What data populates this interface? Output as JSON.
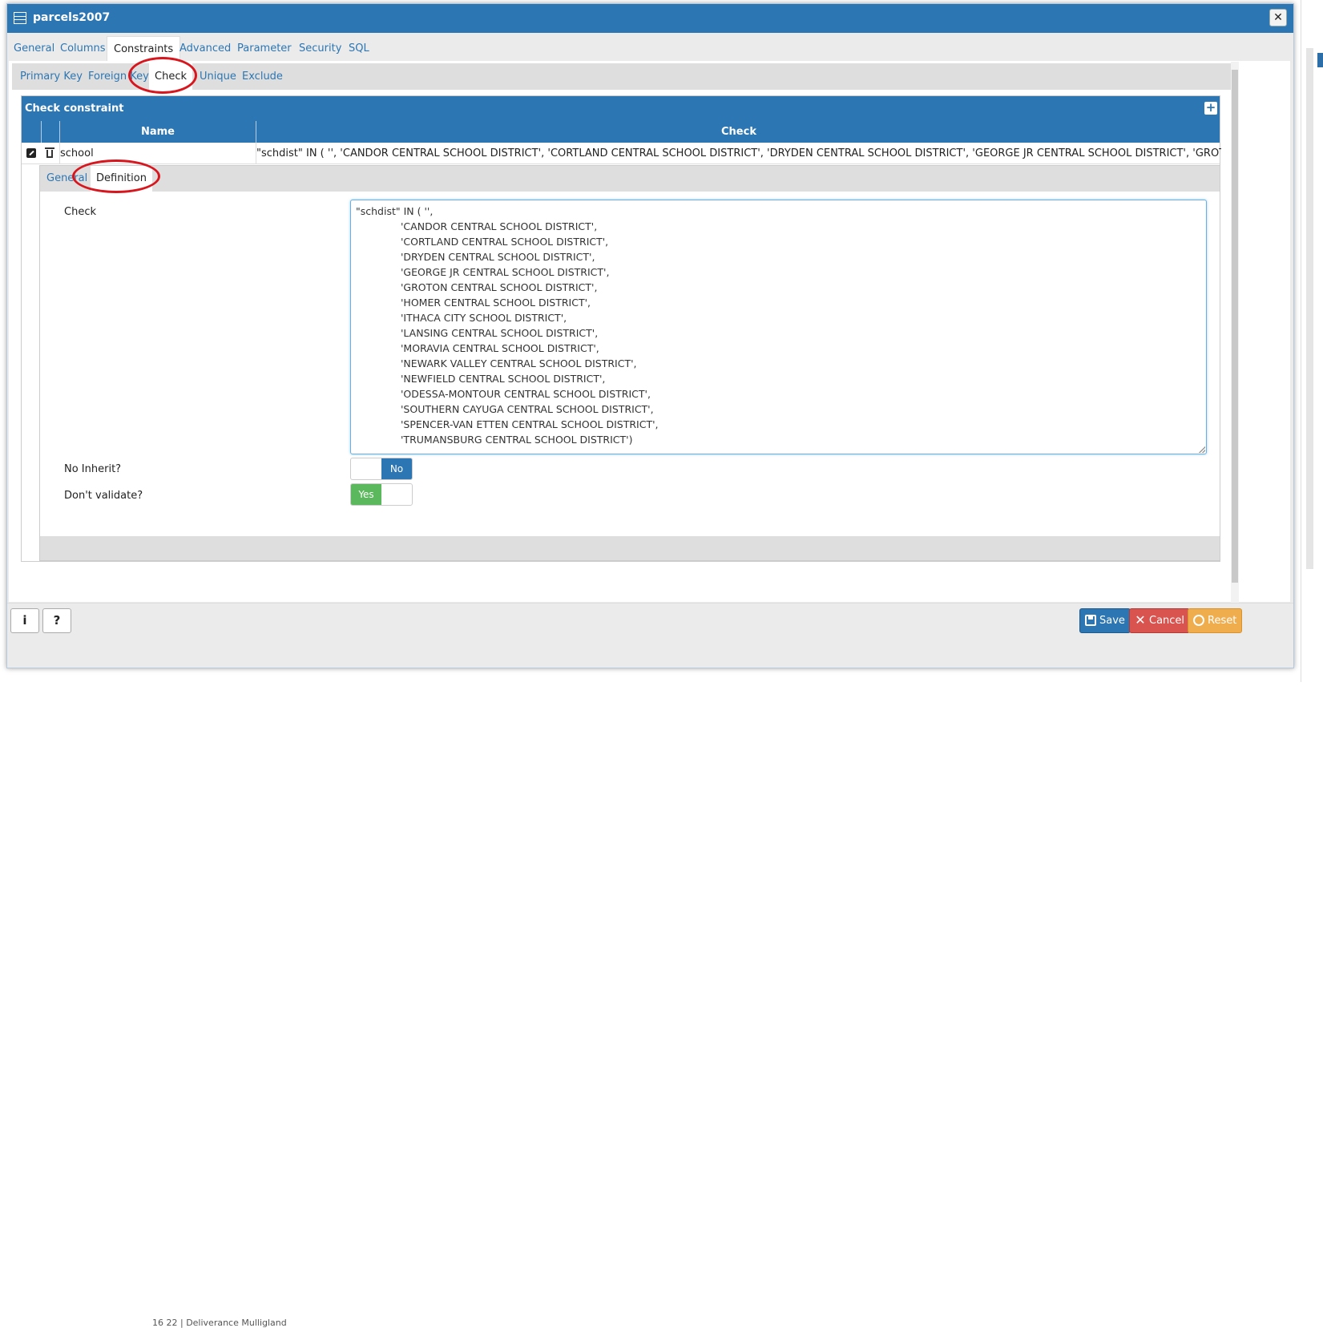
{
  "window": {
    "title": "parcels2007"
  },
  "main_tabs": [
    {
      "label": "General"
    },
    {
      "label": "Columns"
    },
    {
      "label": "Constraints"
    },
    {
      "label": "Advanced"
    },
    {
      "label": "Parameter"
    },
    {
      "label": "Security"
    },
    {
      "label": "SQL"
    }
  ],
  "constraint_tabs": [
    {
      "label": "Primary Key"
    },
    {
      "label": "Foreign Key"
    },
    {
      "label": "Check"
    },
    {
      "label": "Unique"
    },
    {
      "label": "Exclude"
    }
  ],
  "panel": {
    "title": "Check constraint",
    "columns": {
      "name": "Name",
      "check": "Check"
    },
    "row": {
      "name": "school",
      "check": "\"schdist\" IN ( '', 'CANDOR CENTRAL SCHOOL DISTRICT', 'CORTLAND CENTRAL SCHOOL DISTRICT', 'DRYDEN CENTRAL SCHOOL DISTRICT', 'GEORGE JR CENTRAL SCHOOL DISTRICT', 'GROTON CENT..."
    }
  },
  "detail": {
    "tabs": [
      {
        "label": "General"
      },
      {
        "label": "Definition"
      }
    ],
    "check_label": "Check",
    "check_lines": [
      "\"schdist\" IN ( '',",
      "'CANDOR CENTRAL SCHOOL DISTRICT',",
      "'CORTLAND CENTRAL SCHOOL DISTRICT',",
      "'DRYDEN CENTRAL SCHOOL DISTRICT',",
      "'GEORGE JR CENTRAL SCHOOL DISTRICT',",
      "'GROTON CENTRAL SCHOOL DISTRICT',",
      "'HOMER CENTRAL SCHOOL DISTRICT',",
      "'ITHACA CITY SCHOOL DISTRICT',",
      "'LANSING CENTRAL SCHOOL DISTRICT',",
      "'MORAVIA CENTRAL SCHOOL DISTRICT',",
      "'NEWARK VALLEY CENTRAL SCHOOL DISTRICT',",
      "'NEWFIELD CENTRAL SCHOOL DISTRICT',",
      "'ODESSA-MONTOUR CENTRAL SCHOOL DISTRICT',",
      "'SOUTHERN CAYUGA CENTRAL SCHOOL DISTRICT',",
      "'SPENCER-VAN ETTEN CENTRAL SCHOOL DISTRICT',",
      "'TRUMANSBURG CENTRAL SCHOOL DISTRICT')"
    ],
    "no_inherit_label": "No Inherit?",
    "no_inherit_value": "No",
    "dont_validate_label": "Don't validate?",
    "dont_validate_value": "Yes"
  },
  "footer": {
    "info_label": "i",
    "help_label": "?",
    "save_label": "Save",
    "cancel_label": "Cancel",
    "reset_label": "Reset"
  },
  "background_text": "16      22 | Deliverance Mulligland",
  "colors": {
    "accent": "#2c76b3",
    "success": "#5cb85c",
    "danger": "#d9534f",
    "warning": "#f0ad4e",
    "annotation": "#d7161e"
  }
}
